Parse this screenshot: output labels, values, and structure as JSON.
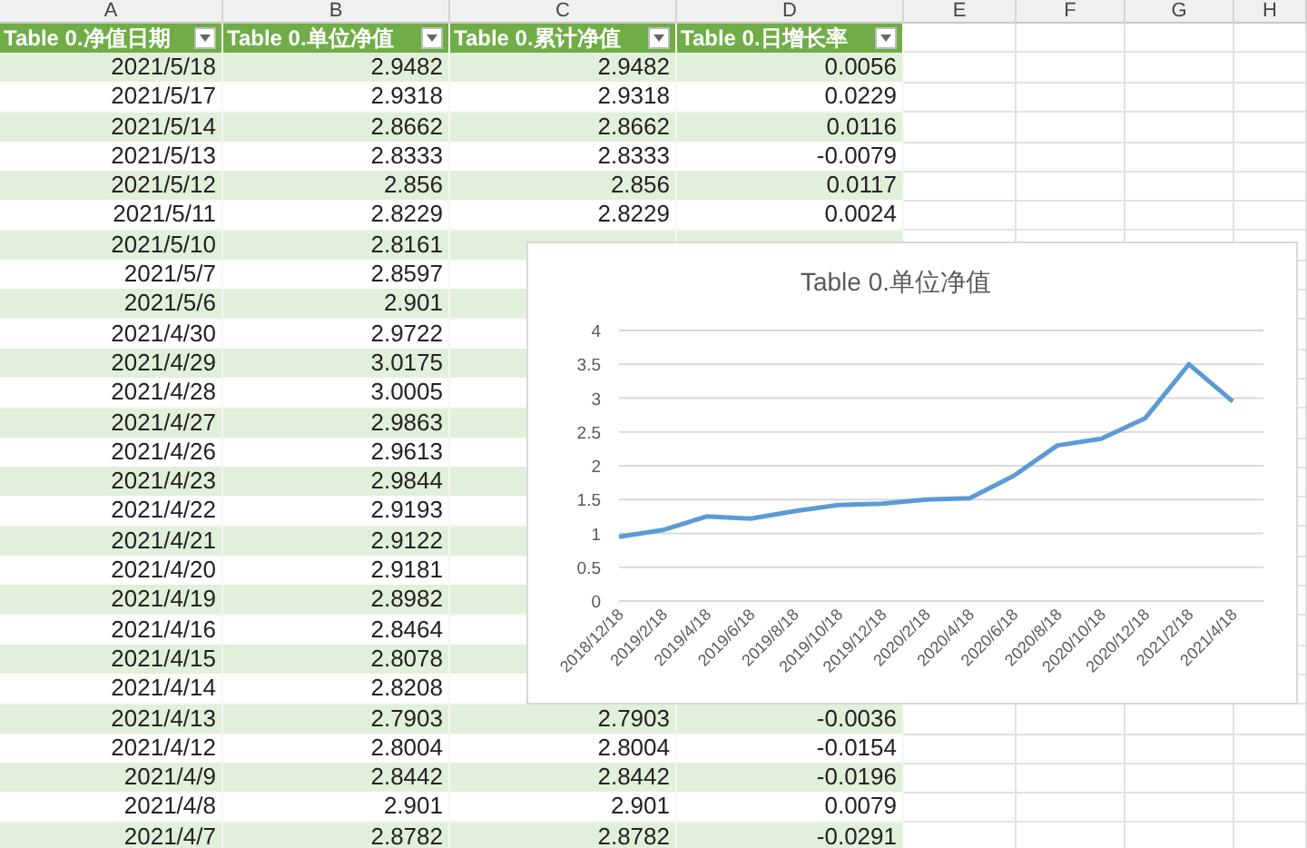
{
  "column_letters": [
    "A",
    "B",
    "C",
    "D",
    "E",
    "F",
    "G",
    "H"
  ],
  "table": {
    "columns": [
      "Table 0.净值日期",
      "Table 0.单位净值",
      "Table 0.累计净值",
      "Table 0.日增长率"
    ],
    "rows": [
      {
        "a": "2021/5/18",
        "b": "2.9482",
        "c": "2.9482",
        "d": "0.0056"
      },
      {
        "a": "2021/5/17",
        "b": "2.9318",
        "c": "2.9318",
        "d": "0.0229"
      },
      {
        "a": "2021/5/14",
        "b": "2.8662",
        "c": "2.8662",
        "d": "0.0116"
      },
      {
        "a": "2021/5/13",
        "b": "2.8333",
        "c": "2.8333",
        "d": "-0.0079"
      },
      {
        "a": "2021/5/12",
        "b": "2.856",
        "c": "2.856",
        "d": "0.0117"
      },
      {
        "a": "2021/5/11",
        "b": "2.8229",
        "c": "2.8229",
        "d": "0.0024"
      },
      {
        "a": "2021/5/10",
        "b": "2.8161"
      },
      {
        "a": "2021/5/7",
        "b": "2.8597"
      },
      {
        "a": "2021/5/6",
        "b": "2.901"
      },
      {
        "a": "2021/4/30",
        "b": "2.9722"
      },
      {
        "a": "2021/4/29",
        "b": "3.0175"
      },
      {
        "a": "2021/4/28",
        "b": "3.0005"
      },
      {
        "a": "2021/4/27",
        "b": "2.9863"
      },
      {
        "a": "2021/4/26",
        "b": "2.9613"
      },
      {
        "a": "2021/4/23",
        "b": "2.9844"
      },
      {
        "a": "2021/4/22",
        "b": "2.9193"
      },
      {
        "a": "2021/4/21",
        "b": "2.9122"
      },
      {
        "a": "2021/4/20",
        "b": "2.9181"
      },
      {
        "a": "2021/4/19",
        "b": "2.8982"
      },
      {
        "a": "2021/4/16",
        "b": "2.8464"
      },
      {
        "a": "2021/4/15",
        "b": "2.8078"
      },
      {
        "a": "2021/4/14",
        "b": "2.8208"
      },
      {
        "a": "2021/4/13",
        "b": "2.7903",
        "c": "2.7903",
        "d": "-0.0036"
      },
      {
        "a": "2021/4/12",
        "b": "2.8004",
        "c": "2.8004",
        "d": "-0.0154"
      },
      {
        "a": "2021/4/9",
        "b": "2.8442",
        "c": "2.8442",
        "d": "-0.0196"
      },
      {
        "a": "2021/4/8",
        "b": "2.901",
        "c": "2.901",
        "d": "0.0079"
      },
      {
        "a": "2021/4/7",
        "b": "2.8782",
        "c": "2.8782",
        "d": "-0.0291"
      }
    ]
  },
  "chart": {
    "chart_data": {
      "type": "line",
      "title": "Table 0.单位净值",
      "x": [
        "2018/12/18",
        "2019/2/18",
        "2019/4/18",
        "2019/6/18",
        "2019/8/18",
        "2019/10/18",
        "2019/12/18",
        "2020/2/18",
        "2020/4/18",
        "2020/6/18",
        "2020/8/18",
        "2020/10/18",
        "2020/12/18",
        "2021/2/18",
        "2021/4/18"
      ],
      "series": [
        {
          "color": "#5b9bd5",
          "values": [
            0.95,
            1.05,
            1.25,
            1.22,
            1.33,
            1.42,
            1.44,
            1.5,
            1.52,
            1.85,
            2.3,
            2.4,
            2.7,
            3.5,
            2.95
          ]
        }
      ],
      "ylim": [
        0,
        4
      ],
      "yticks": [
        0,
        0.5,
        1,
        1.5,
        2,
        2.5,
        3,
        3.5,
        4
      ],
      "grid": true
    }
  }
}
